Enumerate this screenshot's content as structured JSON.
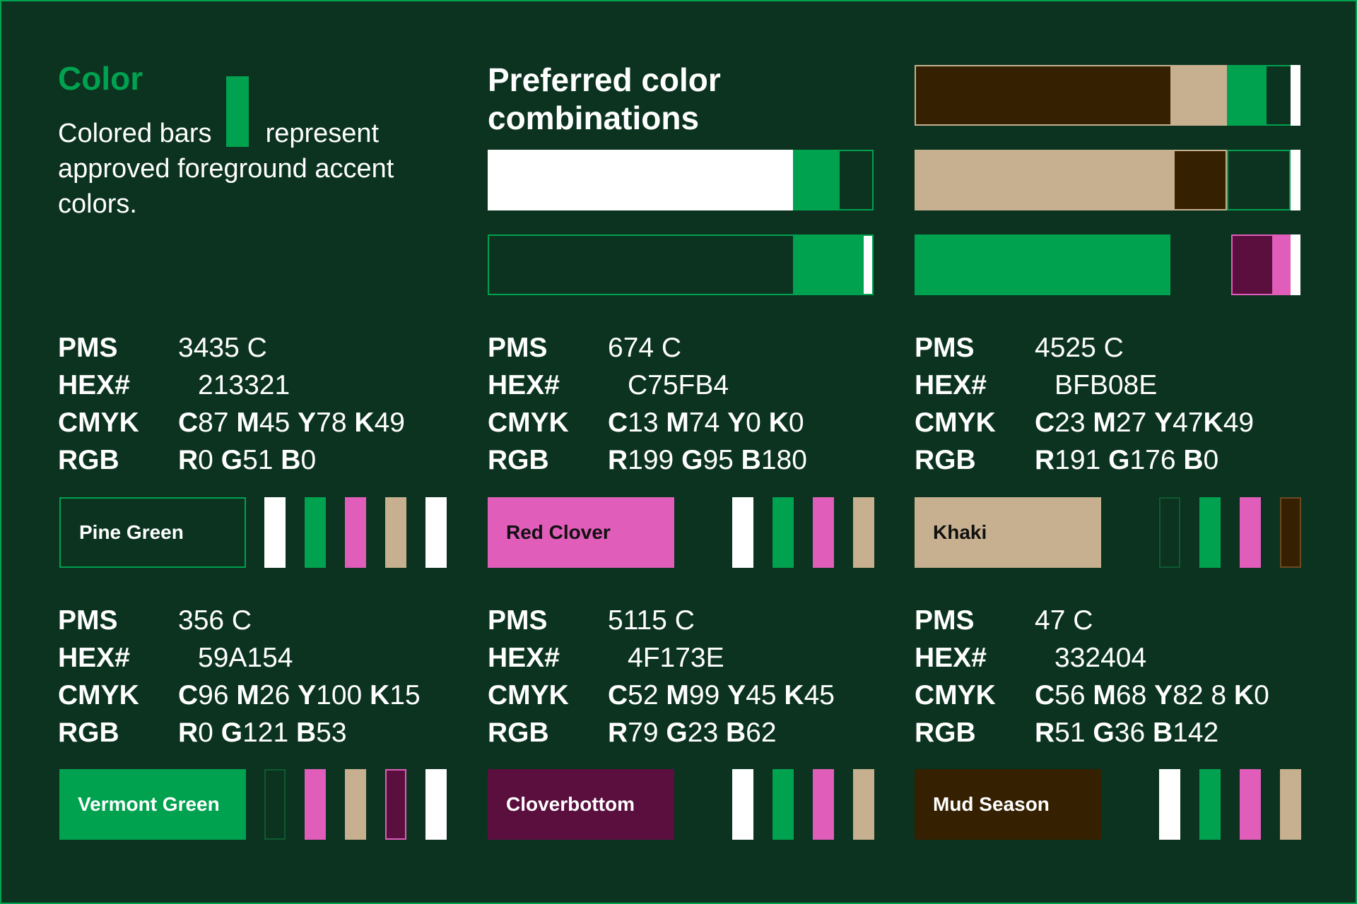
{
  "intro": {
    "title": "Color",
    "line1_a": "Colored bars",
    "line1_b": "represent",
    "line2": "approved foreground accent",
    "line3": "colors."
  },
  "combinations": {
    "title_line1": "Preferred color",
    "title_line2": "combinations"
  },
  "colors": {
    "pine_green": "#0b3320",
    "vermont_green": "#00a14f",
    "red_clover": "#e05dba",
    "cloverbottom": "#5a0f3e",
    "khaki": "#c7b08f",
    "mud_season": "#352101",
    "white": "#ffffff"
  },
  "specs": [
    {
      "name": "Pine Green",
      "pms_label": "PMS",
      "pms": "3435 C",
      "hex_label": "HEX#",
      "hex": "213321",
      "cmyk_label": "CMYK",
      "cmyk": [
        "87",
        "45",
        "78",
        "49"
      ],
      "rgb_label": "RGB",
      "rgb": [
        "0",
        "51",
        "0"
      ]
    },
    {
      "name": "Red Clover",
      "pms_label": "PMS",
      "pms": "674 C",
      "hex_label": "HEX#",
      "hex": "C75FB4",
      "cmyk_label": "CMYK",
      "cmyk": [
        "13",
        "74",
        "0",
        "0"
      ],
      "rgb_label": "RGB",
      "rgb": [
        "199",
        "95",
        "180"
      ]
    },
    {
      "name": "Khaki",
      "pms_label": "PMS",
      "pms": "4525 C",
      "hex_label": "HEX#",
      "hex": "BFB08E",
      "cmyk_label": "CMYK",
      "cmyk": [
        "23",
        "27",
        "47",
        "49"
      ],
      "rgb_label": "RGB",
      "rgb": [
        "191",
        "176",
        "0"
      ]
    },
    {
      "name": "Vermont Green",
      "pms_label": "PMS",
      "pms": "356 C",
      "hex_label": "HEX#",
      "hex": "59A154",
      "cmyk_label": "CMYK",
      "cmyk": [
        "96",
        "26",
        "100",
        "15"
      ],
      "rgb_label": "RGB",
      "rgb": [
        "0",
        "121",
        "53"
      ]
    },
    {
      "name": "Cloverbottom",
      "pms_label": "PMS",
      "pms": "5115 C",
      "hex_label": "HEX#",
      "hex": "4F173E",
      "cmyk_label": "CMYK",
      "cmyk": [
        "52",
        "99",
        "45",
        "45"
      ],
      "rgb_label": "RGB",
      "rgb": [
        "79",
        "23",
        "62"
      ]
    },
    {
      "name": "Mud Season",
      "pms_label": "PMS",
      "pms": "47 C",
      "hex_label": "HEX#",
      "hex": "332404",
      "cmyk_label": "CMYK",
      "cmyk": [
        "56",
        "68",
        "82 8",
        "0"
      ],
      "rgb_label": "RGB",
      "rgb": [
        "51",
        "36",
        "142"
      ]
    }
  ]
}
